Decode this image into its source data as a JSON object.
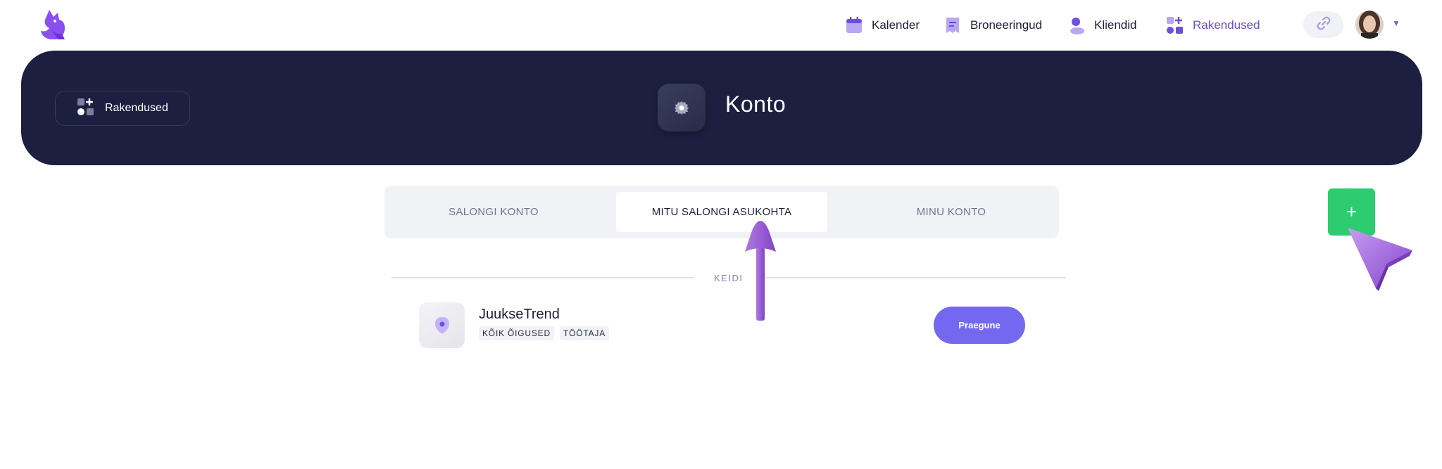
{
  "nav": {
    "items": [
      {
        "label": "Kalender",
        "icon": "calendar-icon"
      },
      {
        "label": "Broneeringud",
        "icon": "bookings-icon"
      },
      {
        "label": "Kliendid",
        "icon": "clients-icon"
      },
      {
        "label": "Rakendused",
        "icon": "apps-icon",
        "active": true
      }
    ]
  },
  "hero": {
    "back_label": "Rakendused",
    "title": "Konto"
  },
  "tabs": [
    {
      "label": "SALONGI KONTO"
    },
    {
      "label": "MITU SALONGI ASUKOHTA",
      "active": true
    },
    {
      "label": "MINU KONTO"
    }
  ],
  "add_button": {
    "label": "+"
  },
  "section": {
    "label": "KEIDI"
  },
  "location": {
    "name": "JuukseTrend",
    "tags": [
      "KÕIK ÕIGUSED",
      "TÖÖTAJA"
    ],
    "status_button": "Praegune"
  },
  "colors": {
    "accent": "#6b4fe0",
    "hero_bg": "#1c1f3f",
    "add_green": "#2ecc71",
    "button_purple": "#7568f0"
  }
}
